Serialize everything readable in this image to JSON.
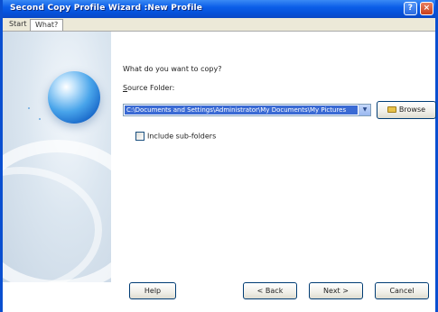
{
  "window": {
    "title": "Second Copy Profile Wizard :New Profile",
    "help_glyph": "?",
    "close_glyph": "×"
  },
  "tabs": [
    {
      "label": "Start"
    },
    {
      "label": "What?"
    }
  ],
  "form": {
    "question": "What do you want to copy?",
    "source_label_accel": "S",
    "source_label_rest": "ource Folder:",
    "source_path": "C:\\Documents and Settings\\Administrator\\My Documents\\My Pictures",
    "dropdown_glyph": "▼",
    "browse_label": "Browse",
    "include_subfolders_label": "Include sub-folders",
    "include_subfolders_checked": false
  },
  "footer": {
    "help_label": "Help",
    "back_label": "< Back",
    "next_label": "Next >",
    "cancel_label": "Cancel"
  },
  "colors": {
    "titlebar": "#0b5ee8",
    "selection": "#3a6ad4",
    "panel": "#dbe6f0"
  }
}
